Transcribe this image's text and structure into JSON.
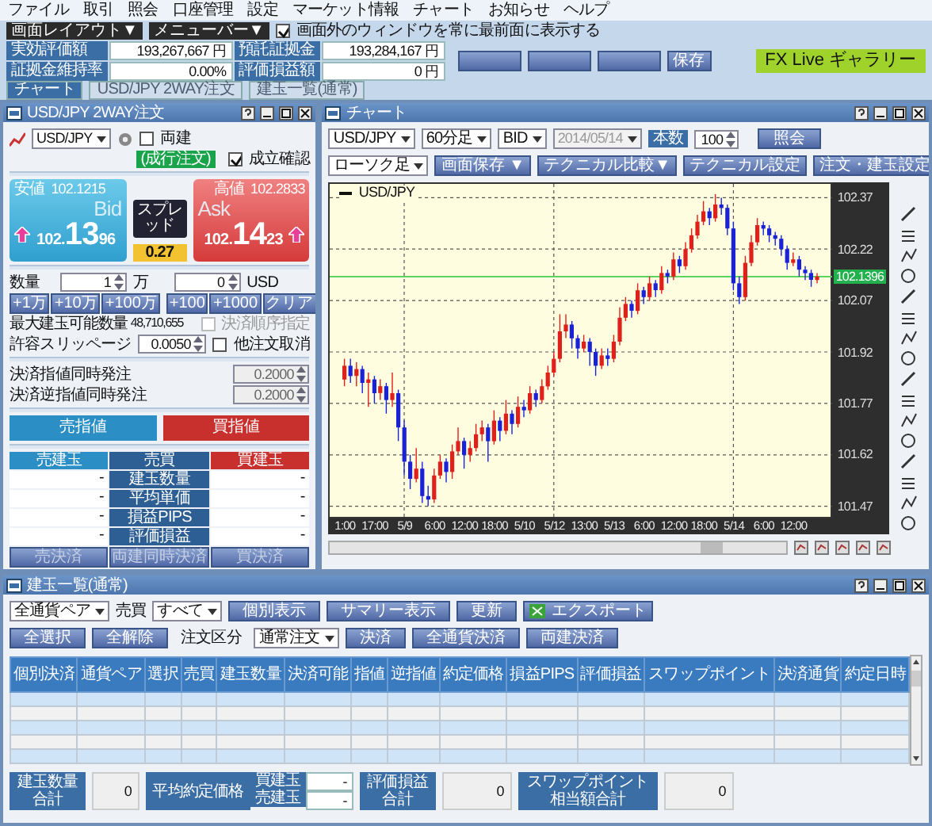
{
  "menu": [
    "ファイル",
    "取引",
    "照会",
    "口座管理",
    "設定",
    "マーケット情報",
    "チャート",
    "お知らせ",
    "ヘルプ"
  ],
  "toolbar": {
    "layout_button": "画面レイアウト▼",
    "menu_button": "メニューバー▼",
    "topmost": {
      "label": "画面外のウィンドウを常に最前面に表示する",
      "checked": true
    }
  },
  "account": [
    {
      "label": "実効評価額",
      "value": "193,267,667",
      "unit": "円"
    },
    {
      "label": "預託証拠金",
      "value": "193,284,167",
      "unit": "円"
    },
    {
      "label": "証拠金維持率",
      "value": "0.00%"
    },
    {
      "label": "評価損益額",
      "value": "0",
      "unit": "円"
    }
  ],
  "save_button": "保存",
  "gallery_button": "FX Live ギャラリー",
  "window_tabs": [
    {
      "label": "チャート",
      "selected": true
    },
    {
      "label": "USD/JPY 2WAY注文",
      "selected": false
    },
    {
      "label": "建玉一覧(通常)",
      "selected": false
    }
  ],
  "order_window": {
    "title": "USD/JPY 2WAY注文",
    "pair": "USD/JPY",
    "hedge": {
      "label": "両建",
      "checked": false
    },
    "mode_badge": "(成行注文)",
    "confirm": {
      "label": "成立確認",
      "checked": true
    },
    "bid": {
      "low_label": "安値",
      "low": "102.1215",
      "caption": "Bid",
      "price_head": "102.",
      "price_big": "13",
      "price_tail": "96"
    },
    "spread": {
      "label": "スプレッド",
      "value": "0.27"
    },
    "ask": {
      "caption": "Ask",
      "high_label": "高値",
      "high": "102.2833",
      "price_head": "102.",
      "price_big": "14",
      "price_tail": "23"
    },
    "quantity": {
      "label": "数量",
      "lots": "1",
      "lots_unit": "万",
      "units": "0",
      "units_unit": "USD"
    },
    "lot_buttons": [
      "+1万",
      "+10万",
      "+100万"
    ],
    "unit_buttons": [
      "+100",
      "+1000"
    ],
    "clear_button": "クリア",
    "max_label": "最大建玉可能数量",
    "max_value": "48,710,655",
    "order_sequence": {
      "label": "決済順序指定",
      "checked": false,
      "disabled": true
    },
    "slippage_label": "許容スリッページ",
    "slippage": "0.0050",
    "cancel_others": {
      "label": "他注文取消",
      "checked": false
    },
    "settlements": [
      {
        "label": "決済指値同時発注",
        "value": "0.2000",
        "disabled": true
      },
      {
        "label": "決済逆指値同時発注",
        "value": "0.2000",
        "disabled": true
      }
    ],
    "order_buttons": [
      {
        "label": "売指値",
        "kind": "sell"
      },
      {
        "label": "買指値",
        "kind": "buy"
      }
    ],
    "position_headers": [
      {
        "label": "売建玉",
        "kind": "sell"
      },
      {
        "label": "売買",
        "kind": "middle"
      },
      {
        "label": "買建玉",
        "kind": "buy"
      }
    ],
    "position_rows": [
      {
        "label": "建玉数量",
        "sell": "-",
        "buy": "-"
      },
      {
        "label": "平均単価",
        "sell": "-",
        "buy": "-"
      },
      {
        "label": "損益PIPS",
        "sell": "-",
        "buy": "-"
      },
      {
        "label": "評価損益",
        "sell": "-",
        "buy": "-"
      }
    ],
    "position_buttons": [
      {
        "label": "売決済",
        "disabled": true
      },
      {
        "label": "両建同時決済",
        "disabled": true
      },
      {
        "label": "買決済",
        "disabled": true
      }
    ]
  },
  "chart_window": {
    "title": "チャート",
    "pair": "USD/JPY",
    "period": "60分足",
    "side": "BID",
    "date": "2014/05/14",
    "count_label": "本数",
    "count": "100",
    "query_button": "照会",
    "style": "ローソク足",
    "buttons": [
      "画面保存 ▼",
      "テクニカル比較▼",
      "テクニカル設定",
      "注文・建玉設定"
    ],
    "legend": "USD/JPY",
    "current_price": "102.1396",
    "chart_data": {
      "type": "candlestick",
      "grid": true,
      "ref_lines": [
        {
          "axis": "y",
          "value": 102.1396,
          "color": "#5fd35f"
        }
      ],
      "categories": [
        "1:00",
        null,
        null,
        null,
        null,
        "17:00",
        null,
        null,
        null,
        null,
        "5/9",
        null,
        null,
        null,
        null,
        "6:00",
        null,
        null,
        null,
        null,
        "12:00",
        null,
        null,
        null,
        null,
        "18:00",
        null,
        null,
        null,
        null,
        "5/10",
        null,
        null,
        null,
        null,
        "5/12",
        null,
        null,
        null,
        null,
        "13:00",
        null,
        null,
        null,
        null,
        "5/13",
        null,
        null,
        null,
        null,
        "6:00",
        null,
        null,
        null,
        null,
        "12:00",
        null,
        null,
        null,
        null,
        "18:00",
        null,
        null,
        null,
        null,
        "5/14",
        null,
        null,
        null,
        null,
        "6:00",
        null,
        null,
        null,
        null,
        "12:00",
        null,
        null,
        null,
        null
      ],
      "ylim": [
        101.43,
        102.41
      ],
      "yticks": [
        102.37,
        102.22,
        102.07,
        101.92,
        101.77,
        101.62,
        101.47
      ],
      "ohlc": [
        [
          101.84,
          101.9,
          101.82,
          101.88
        ],
        [
          101.88,
          101.9,
          101.83,
          101.85
        ],
        [
          101.85,
          101.89,
          101.82,
          101.87
        ],
        [
          101.87,
          101.88,
          101.8,
          101.83
        ],
        [
          101.83,
          101.86,
          101.76,
          101.84
        ],
        [
          101.84,
          101.85,
          101.77,
          101.8
        ],
        [
          101.8,
          101.84,
          101.78,
          101.82
        ],
        [
          101.82,
          101.83,
          101.74,
          101.78
        ],
        [
          101.78,
          101.86,
          101.76,
          101.8
        ],
        [
          101.8,
          101.81,
          101.66,
          101.7
        ],
        [
          101.7,
          101.72,
          101.56,
          101.6
        ],
        [
          101.6,
          101.62,
          101.52,
          101.55
        ],
        [
          101.55,
          101.64,
          101.54,
          101.58
        ],
        [
          101.58,
          101.6,
          101.48,
          101.5
        ],
        [
          101.5,
          101.53,
          101.47,
          101.49
        ],
        [
          101.49,
          101.58,
          101.48,
          101.56
        ],
        [
          101.56,
          101.62,
          101.55,
          101.6
        ],
        [
          101.6,
          101.61,
          101.54,
          101.57
        ],
        [
          101.57,
          101.65,
          101.55,
          101.63
        ],
        [
          101.63,
          101.7,
          101.62,
          101.66
        ],
        [
          101.66,
          101.67,
          101.58,
          101.62
        ],
        [
          101.62,
          101.66,
          101.6,
          101.64
        ],
        [
          101.64,
          101.71,
          101.63,
          101.68
        ],
        [
          101.68,
          101.72,
          101.66,
          101.7
        ],
        [
          101.7,
          101.71,
          101.6,
          101.66
        ],
        [
          101.66,
          101.75,
          101.65,
          101.72
        ],
        [
          101.72,
          101.73,
          101.66,
          101.69
        ],
        [
          101.69,
          101.78,
          101.68,
          101.74
        ],
        [
          101.74,
          101.75,
          101.68,
          101.71
        ],
        [
          101.71,
          101.79,
          101.7,
          101.76
        ],
        [
          101.76,
          101.78,
          101.73,
          101.75
        ],
        [
          101.75,
          101.82,
          101.74,
          101.8
        ],
        [
          101.8,
          101.81,
          101.76,
          101.78
        ],
        [
          101.78,
          101.84,
          101.77,
          101.82
        ],
        [
          101.82,
          101.88,
          101.81,
          101.86
        ],
        [
          101.86,
          101.92,
          101.85,
          101.9
        ],
        [
          101.9,
          102.03,
          101.89,
          101.98
        ],
        [
          101.98,
          102.03,
          101.96,
          102.0
        ],
        [
          102.0,
          102.01,
          101.93,
          101.96
        ],
        [
          101.96,
          101.97,
          101.9,
          101.93
        ],
        [
          101.93,
          101.97,
          101.92,
          101.95
        ],
        [
          101.95,
          101.96,
          101.88,
          101.92
        ],
        [
          101.92,
          101.93,
          101.85,
          101.88
        ],
        [
          101.88,
          101.93,
          101.87,
          101.91
        ],
        [
          101.91,
          101.93,
          101.88,
          101.9
        ],
        [
          101.9,
          101.97,
          101.89,
          101.95
        ],
        [
          101.95,
          102.05,
          101.94,
          102.02
        ],
        [
          102.02,
          102.08,
          102.01,
          102.06
        ],
        [
          102.06,
          102.07,
          102.02,
          102.04
        ],
        [
          102.04,
          102.12,
          102.03,
          102.1
        ],
        [
          102.1,
          102.11,
          102.06,
          102.08
        ],
        [
          102.08,
          102.14,
          102.07,
          102.12
        ],
        [
          102.12,
          102.13,
          102.08,
          102.1
        ],
        [
          102.1,
          102.17,
          102.09,
          102.15
        ],
        [
          102.15,
          102.16,
          102.12,
          102.14
        ],
        [
          102.14,
          102.21,
          102.13,
          102.19
        ],
        [
          102.19,
          102.2,
          102.15,
          102.17
        ],
        [
          102.17,
          102.24,
          102.16,
          102.22
        ],
        [
          102.22,
          102.28,
          102.21,
          102.26
        ],
        [
          102.26,
          102.32,
          102.25,
          102.3
        ],
        [
          102.3,
          102.36,
          102.29,
          102.33
        ],
        [
          102.33,
          102.34,
          102.29,
          102.31
        ],
        [
          102.31,
          102.38,
          102.3,
          102.35
        ],
        [
          102.35,
          102.37,
          102.32,
          102.34
        ],
        [
          102.34,
          102.35,
          102.26,
          102.28
        ],
        [
          102.28,
          102.3,
          102.1,
          102.12
        ],
        [
          102.12,
          102.14,
          102.06,
          102.08
        ],
        [
          102.08,
          102.2,
          102.07,
          102.18
        ],
        [
          102.18,
          102.26,
          102.17,
          102.24
        ],
        [
          102.24,
          102.31,
          102.23,
          102.29
        ],
        [
          102.29,
          102.3,
          102.26,
          102.28
        ],
        [
          102.28,
          102.29,
          102.24,
          102.26
        ],
        [
          102.26,
          102.27,
          102.23,
          102.25
        ],
        [
          102.25,
          102.26,
          102.2,
          102.22
        ],
        [
          102.22,
          102.23,
          102.16,
          102.18
        ],
        [
          102.18,
          102.21,
          102.17,
          102.19
        ],
        [
          102.19,
          102.2,
          102.14,
          102.16
        ],
        [
          102.16,
          102.17,
          102.13,
          102.15
        ],
        [
          102.15,
          102.16,
          102.11,
          102.13
        ],
        [
          102.13,
          102.15,
          102.12,
          102.14
        ]
      ]
    }
  },
  "positions_window": {
    "title": "建玉一覧(通常)",
    "pair_filter": "全通貨ペア",
    "side_label": "売買",
    "side_filter": "すべて",
    "buttons": [
      "個別表示",
      "サマリー表示",
      "更新"
    ],
    "export_button": "エクスポート",
    "select_all": "全選択",
    "clear_all": "全解除",
    "order_type_label": "注文区分",
    "order_type": "通常注文",
    "action_buttons": [
      "決済",
      "全通貨決済",
      "両建決済"
    ],
    "columns": [
      "個別決済",
      "通貨ペア",
      "選択",
      "売買",
      "建玉数量",
      "決済可能",
      "指値",
      "逆指値",
      "約定価格",
      "損益PIPS",
      "評価損益",
      "スワップポイント",
      "決済通貨",
      "約定日時"
    ],
    "summary": {
      "quantity_label": "建玉数量合計",
      "quantity": "0",
      "avg_label": "平均約定価格",
      "buy_label": "買建玉",
      "buy": "-",
      "sell_label": "売建玉",
      "sell": "-",
      "pl_label": "評価損益合計",
      "pl": "0",
      "swap_label": "スワップポイント相当額合計",
      "swap": "0"
    }
  }
}
